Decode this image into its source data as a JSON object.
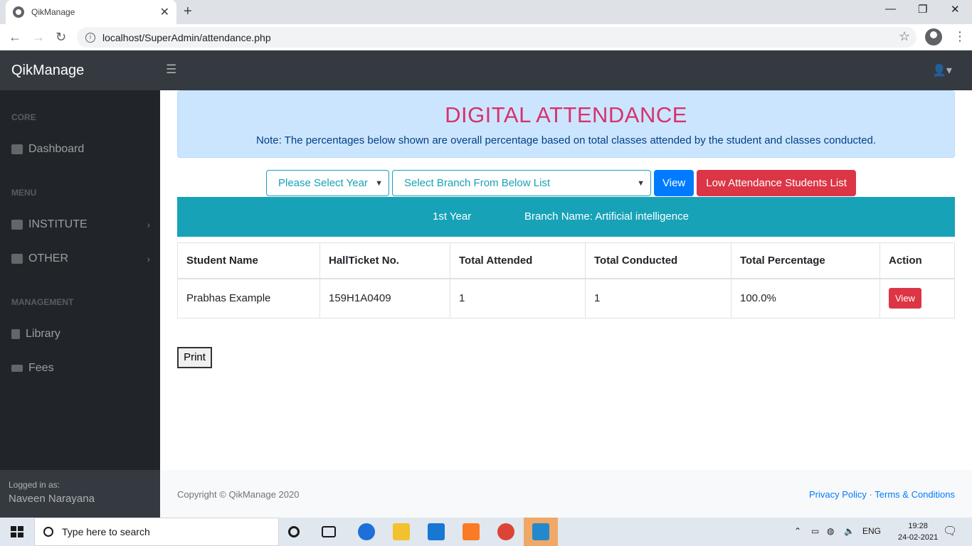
{
  "browser": {
    "tab_title": "QikManage",
    "url": "localhost/SuperAdmin/attendance.php"
  },
  "app": {
    "brand": "QikManage"
  },
  "sidebar": {
    "sections": [
      {
        "heading": "CORE",
        "items": [
          "Dashboard"
        ]
      },
      {
        "heading": "MENU",
        "items": [
          "INSTITUTE",
          "OTHER"
        ]
      },
      {
        "heading": "MANAGEMENT",
        "items": [
          "Library",
          "Fees"
        ]
      }
    ],
    "footer": {
      "label": "Logged in as:",
      "user": "Naveen Narayana"
    }
  },
  "main": {
    "title": "DIGITAL ATTENDANCE",
    "note": "Note: The percentages below shown are overall percentage based on total classes attended by the student and classes conducted.",
    "year_select": "Please Select Year",
    "branch_select": "Select Branch From Below List",
    "view_button": "View",
    "low_attendance_button": "Low Attendance Students List",
    "info_year": "1st Year",
    "info_branch": "Branch Name: Artificial intelligence",
    "table": {
      "headers": [
        "Student Name",
        "HallTicket No.",
        "Total Attended",
        "Total Conducted",
        "Total Percentage",
        "Action"
      ],
      "rows": [
        {
          "name": "Prabhas Example",
          "hallticket": "159H1A0409",
          "attended": "1",
          "conducted": "1",
          "percentage": "100.0%",
          "action": "View"
        }
      ]
    },
    "print_button": "Print"
  },
  "footer": {
    "copyright": "Copyright © QikManage 2020",
    "privacy": "Privacy Policy",
    "sep": "·",
    "terms": "Terms & Conditions"
  },
  "taskbar": {
    "search_placeholder": "Type here to search",
    "lang": "ENG",
    "time": "19:28",
    "date": "24-02-2021"
  },
  "colors": {
    "accent_info": "#17a2b8",
    "primary": "#007bff",
    "danger": "#dc3545",
    "title_pink": "#d6336c",
    "sidebar_bg": "#212529",
    "topbar_bg": "#343a40"
  }
}
